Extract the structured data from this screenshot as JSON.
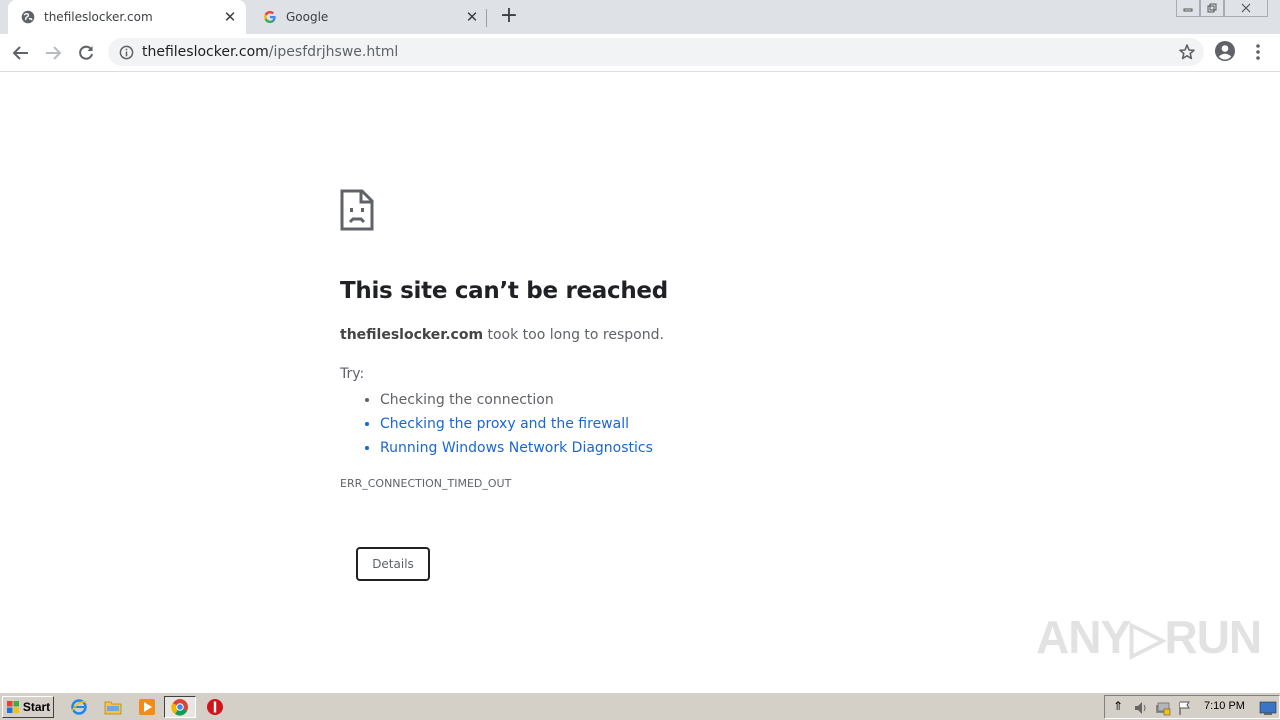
{
  "tabs": [
    {
      "title": "thefileslocker.com",
      "favicon": "globe-icon",
      "active": true
    },
    {
      "title": "Google",
      "favicon": "google-icon",
      "active": false
    }
  ],
  "toolbar": {
    "url_host": "thefileslocker.com",
    "url_path": "/ipesfdrjhswe.html"
  },
  "error": {
    "title": "This site can’t be reached",
    "host": "thefileslocker.com",
    "message": " took too long to respond.",
    "try_label": "Try:",
    "suggestions": [
      {
        "text": "Checking the connection",
        "link": false
      },
      {
        "text": "Checking the proxy and the firewall",
        "link": true
      },
      {
        "text": "Running Windows Network Diagnostics",
        "link": true
      }
    ],
    "code": "ERR_CONNECTION_TIMED_OUT",
    "details_label": "Details"
  },
  "watermark": "ANY RUN",
  "taskbar": {
    "start_label": "Start",
    "clock": "7:10 PM"
  },
  "colors": {
    "link": "#1967d2",
    "tab_strip": "#dee1e6",
    "taskbar": "#d4d0c8"
  }
}
